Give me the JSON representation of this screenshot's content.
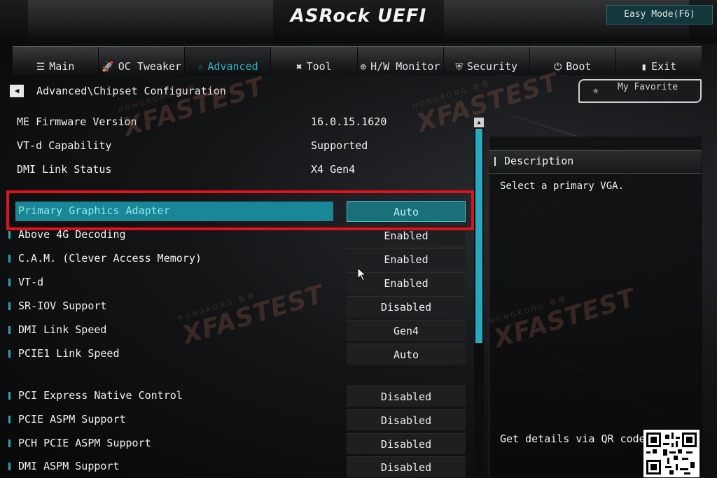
{
  "header": {
    "logo_text": "ASRock UEFI",
    "easy_mode_label": "Easy Mode(F6)"
  },
  "tabs": [
    {
      "label": "Main",
      "icon": "list-icon"
    },
    {
      "label": "OC Tweaker",
      "icon": "rocket-icon"
    },
    {
      "label": "Advanced",
      "icon": "star-icon",
      "active": true
    },
    {
      "label": "Tool",
      "icon": "tools-icon"
    },
    {
      "label": "H/W Monitor",
      "icon": "globe-icon"
    },
    {
      "label": "Security",
      "icon": "shield-icon"
    },
    {
      "label": "Boot",
      "icon": "power-icon"
    },
    {
      "label": "Exit",
      "icon": "exit-door-icon"
    }
  ],
  "breadcrumb": "Advanced\\Chipset Configuration",
  "favorite_label": "My Favorite",
  "info": [
    {
      "label": "ME Firmware Version",
      "value": "16.0.15.1620"
    },
    {
      "label": "VT-d Capability",
      "value": "Supported"
    },
    {
      "label": "DMI Link Status",
      "value": "X4  Gen4"
    }
  ],
  "settings": [
    {
      "label": "Primary Graphics Adapter",
      "value": "Auto",
      "selected": true
    },
    {
      "label": "Above 4G Decoding",
      "value": "Enabled"
    },
    {
      "label": "C.A.M. (Clever Access Memory)",
      "value": "Enabled"
    },
    {
      "label": "VT-d",
      "value": "Enabled"
    },
    {
      "label": "SR-IOV Support",
      "value": "Disabled"
    },
    {
      "label": "DMI Link Speed",
      "value": "Gen4"
    },
    {
      "label": "PCIE1 Link Speed",
      "value": "Auto"
    },
    {
      "label": "PCI Express Native Control",
      "value": "Disabled"
    },
    {
      "label": "PCIE ASPM Support",
      "value": "Disabled"
    },
    {
      "label": "PCH PCIE ASPM Support",
      "value": "Disabled"
    },
    {
      "label": "DMI ASPM Support",
      "value": "Disabled"
    }
  ],
  "description": {
    "title": "Description",
    "text": "Select a primary VGA.",
    "qr_label": "Get details via QR code"
  },
  "watermark": {
    "small": "HONGKONG 香港",
    "big": "XFASTEST"
  },
  "colors": {
    "accent": "#28b8c8",
    "highlight_border": "#e2111b",
    "selected_row": "#1a8797"
  }
}
